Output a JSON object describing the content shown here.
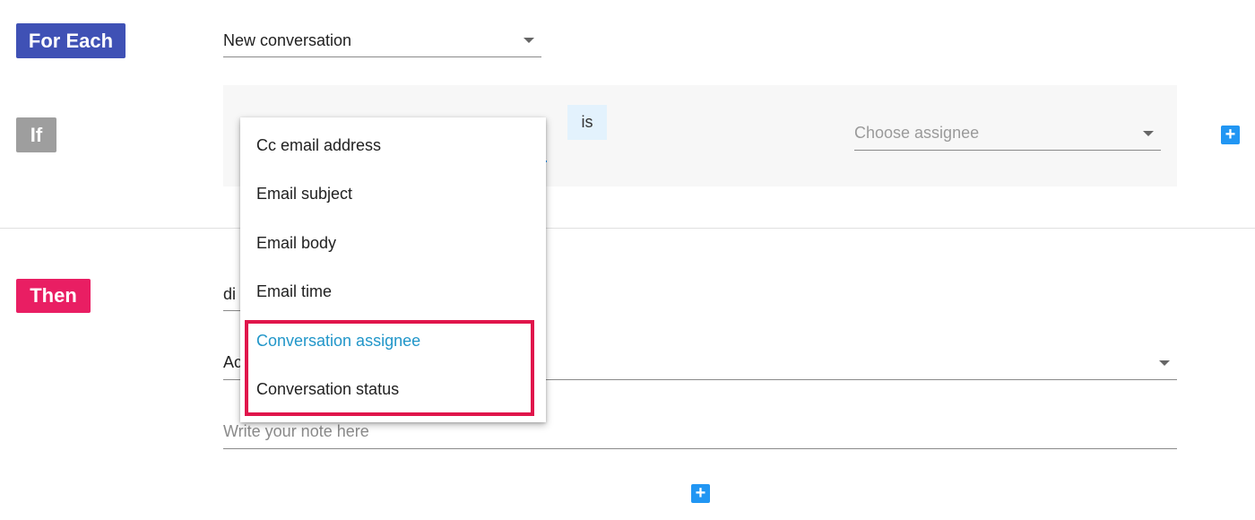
{
  "rule": {
    "for_each_label": "For Each",
    "if_label": "If",
    "then_label": "Then"
  },
  "trigger": {
    "value": "New conversation"
  },
  "condition": {
    "operator": "is",
    "assignee_placeholder": "Choose assignee",
    "add_label": "+"
  },
  "field_menu": {
    "items": [
      {
        "label": "Cc email address"
      },
      {
        "label": "Email subject"
      },
      {
        "label": "Email body"
      },
      {
        "label": "Email time"
      },
      {
        "label": "Conversation assignee",
        "selected": true
      },
      {
        "label": "Conversation status"
      }
    ]
  },
  "action": {
    "select_value_partial": "di",
    "type_value_partial": "Ac",
    "note_placeholder": "Write your note here",
    "add_label": "+"
  },
  "colors": {
    "for_each": "#3f51b5",
    "if": "#9e9e9e",
    "then": "#e91e63",
    "accent": "#2196f3",
    "highlight": "#e0154b"
  }
}
